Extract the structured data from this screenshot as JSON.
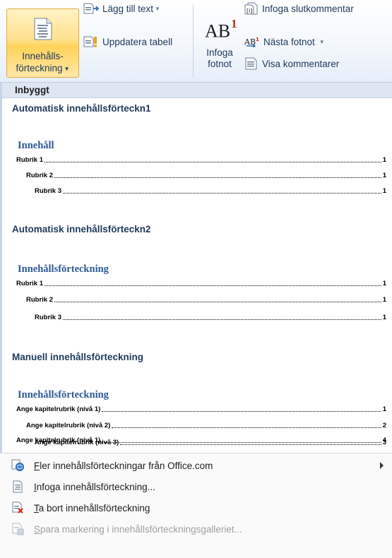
{
  "ribbon": {
    "toc_button_line1": "Innehålls-",
    "toc_button_line2": "förteckning",
    "add_text": "Lägg till text",
    "update_table": "Uppdatera tabell",
    "insert_footnote_line1": "Infoga",
    "insert_footnote_line2": "fotnot",
    "footnote_glyph": "AB",
    "footnote_sup": "1",
    "insert_endnote": "Infoga slutkommentar",
    "next_footnote": "Nästa fotnot",
    "show_comments": "Visa kommentarer"
  },
  "gallery": {
    "section_label": "Inbyggt",
    "items": [
      {
        "title": "Automatisk innehållsförteckn1",
        "heading": "Innehåll",
        "entries": [
          {
            "text": "Rubrik 1",
            "page": "1"
          },
          {
            "text": "Rubrik 2",
            "page": "1"
          },
          {
            "text": "Rubrik 3",
            "page": "1"
          }
        ]
      },
      {
        "title": "Automatisk innehållsförteckn2",
        "heading": "Innehållsförteckning",
        "entries": [
          {
            "text": "Rubrik 1",
            "page": "1"
          },
          {
            "text": "Rubrik 2",
            "page": "1"
          },
          {
            "text": "Rubrik 3",
            "page": "1"
          }
        ]
      },
      {
        "title": "Manuell innehållsförteckning",
        "heading": "Innehållsförteckning",
        "entries": [
          {
            "text": "Ange kapitelrubrik (nivå 1)",
            "page": "1"
          },
          {
            "text": "Ange kapitelrubrik (nivå 2)",
            "page": "2"
          },
          {
            "text": "Ange kapitelrubrik (nivå 3)",
            "page": "3"
          },
          {
            "text": "Ange kapitelrubrik (nivå 1)",
            "page": "4"
          }
        ]
      }
    ]
  },
  "commands": {
    "more_first": "F",
    "more_rest": "ler innehållsförteckningar från Office.com",
    "insert_first": "I",
    "insert_rest": "nfoga innehållsförteckning...",
    "remove_first": "T",
    "remove_rest": "a bort innehållsförteckning",
    "save_first": "S",
    "save_rest": "para markering i innehållsförteckningsgalleriet..."
  },
  "colors": {
    "selected_button": "#ffd35a",
    "heading_blue": "#2c5a95",
    "section_band": "#dde6f1"
  }
}
